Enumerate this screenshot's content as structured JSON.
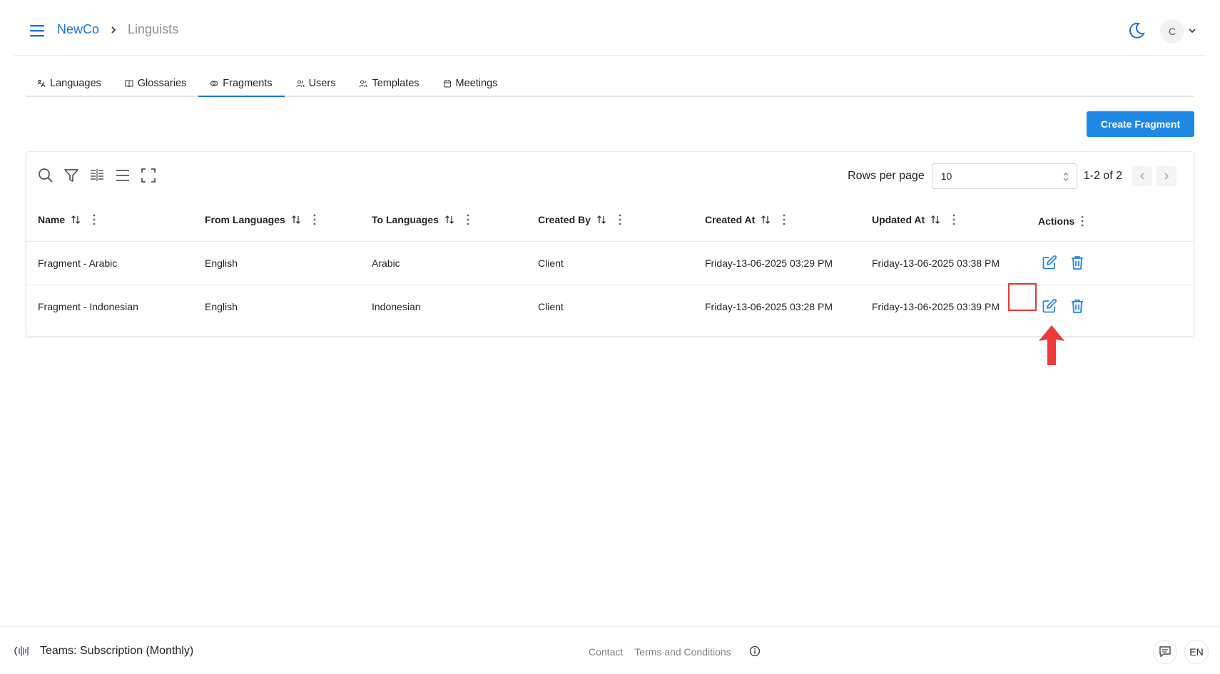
{
  "header": {
    "breadcrumb": {
      "org": "NewCo",
      "current": "Linguists"
    },
    "avatar_initial": "C"
  },
  "tabs": [
    {
      "label": "Languages",
      "icon": "translate-icon",
      "active": false
    },
    {
      "label": "Glossaries",
      "icon": "book-icon",
      "active": false
    },
    {
      "label": "Fragments",
      "icon": "fragments-icon",
      "active": true
    },
    {
      "label": "Users",
      "icon": "users-icon",
      "active": false
    },
    {
      "label": "Templates",
      "icon": "users-icon",
      "active": false
    },
    {
      "label": "Meetings",
      "icon": "calendar-icon",
      "active": false
    }
  ],
  "create_button": "Create Fragment",
  "table": {
    "rows_per_page_label": "Rows per page",
    "rows_per_page_value": "10",
    "page_range": "1-2 of 2",
    "columns": [
      "Name",
      "From Languages",
      "To Languages",
      "Created By",
      "Created At",
      "Updated At",
      "Actions"
    ],
    "rows": [
      {
        "name": "Fragment - Arabic",
        "from": "English",
        "to": "Arabic",
        "created_by": "Client",
        "created_at": "Friday-13-06-2025 03:29 PM",
        "updated_at": "Friday-13-06-2025 03:38 PM"
      },
      {
        "name": "Fragment - Indonesian",
        "from": "English",
        "to": "Indonesian",
        "created_by": "Client",
        "created_at": "Friday-13-06-2025 03:28 PM",
        "updated_at": "Friday-13-06-2025 03:39 PM"
      }
    ]
  },
  "footer": {
    "plan": "Teams: Subscription (Monthly)",
    "contact": "Contact",
    "terms": "Terms and Conditions",
    "language": "EN"
  },
  "colors": {
    "accent": "#1e88e5",
    "highlight": "#e53935",
    "link": "#1976d2"
  }
}
